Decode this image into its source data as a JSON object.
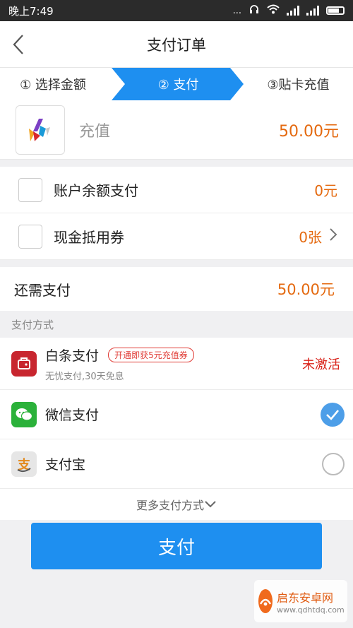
{
  "status_bar": {
    "time": "晚上7:49",
    "dots": "..."
  },
  "header": {
    "title": "支付订单"
  },
  "steps": [
    {
      "label": "① 选择金额",
      "active": false
    },
    {
      "label": "② 支付",
      "active": true
    },
    {
      "label": "③贴卡充值",
      "active": false
    }
  ],
  "product": {
    "name": "充值",
    "price": "50.00元"
  },
  "options": [
    {
      "label": "账户余额支付",
      "value": "0元"
    },
    {
      "label": "现金抵用券",
      "value": "0张"
    }
  ],
  "remaining": {
    "label": "还需支付",
    "value": "50.00元"
  },
  "payment_section": {
    "header": "支付方式",
    "methods": [
      {
        "name": "白条支付",
        "promo": "开通即获5元充值券",
        "subtitle": "无忧支付,30天免息",
        "status": "未激活",
        "icon": "baitiao-icon"
      },
      {
        "name": "微信支付",
        "selected": true,
        "icon": "wechat-pay-icon"
      },
      {
        "name": "支付宝",
        "selected": false,
        "icon": "alipay-icon"
      }
    ],
    "more": "更多支付方式"
  },
  "pay_button": "支付",
  "watermark": {
    "title": "启东安卓网",
    "url": "www.qdhtdq.com"
  },
  "colors": {
    "accent_blue": "#1e8ff0",
    "price_orange": "#e4690f",
    "status_red": "#d9231a"
  }
}
